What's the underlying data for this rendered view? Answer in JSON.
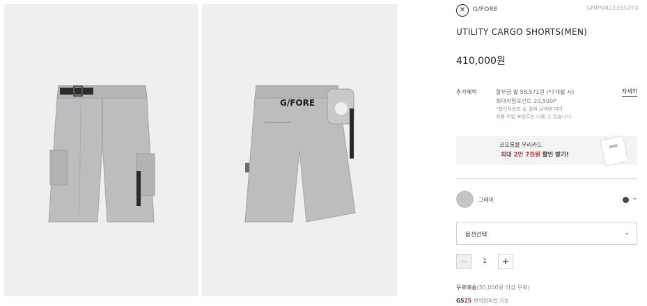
{
  "gallery": {
    "front_image": {
      "alt": "front-view"
    },
    "back_image": {
      "alt": "back-view",
      "print": "G/FORE"
    }
  },
  "brand": {
    "logo_glyph": "✕",
    "name": "G/FORE",
    "product_code": "GMPNM2335SOYX"
  },
  "product": {
    "title": "UTILITY CARGO SHORTS(MEN)",
    "price": "410,000원"
  },
  "benefits": {
    "label": "추가혜택",
    "installment": "할부금 월 58,571원 (*7개월 시)",
    "points": "최대적립포인트 20,500P",
    "note_line1": "*할인적용과 실 결제 금액에 따라",
    "note_line2": "최종 적립 포인트는 다를 수 있습니다.",
    "detail_link": "자세히"
  },
  "card_banner": {
    "title": "코오롱몰 우리카드",
    "promo_prefix": "최대 2만 7천원",
    "promo_suffix": "할인 받기!"
  },
  "color_option": {
    "name": "그레이",
    "swatch_color": "#c4c4c4",
    "dot_color": "#4a4a3c",
    "chevron": "⌄"
  },
  "option_select": {
    "label": "옵션선택",
    "chevron": "⌄"
  },
  "quantity": {
    "minus": "−",
    "value": "1",
    "plus": "+"
  },
  "shipping": {
    "main": "무료배송",
    "sub": "(30,000원 이상 무료)"
  },
  "payment": {
    "badge_text": "GS",
    "badge_number": "25",
    "text": "편의점픽업 가능"
  }
}
